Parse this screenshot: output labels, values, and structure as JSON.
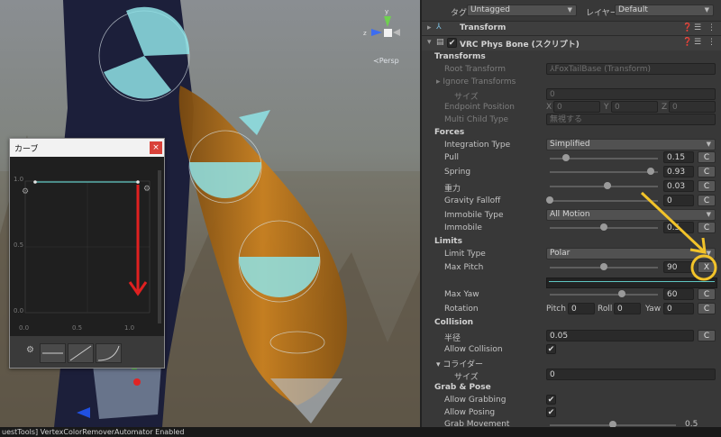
{
  "scene": {
    "persp_label": "≺Persp",
    "gizmo_axes": [
      "y",
      "z",
      "x"
    ]
  },
  "curve_window": {
    "title": "カーブ",
    "close_label": "×",
    "y_labels": [
      "1.0",
      "0.5",
      "0.0"
    ],
    "x_labels": [
      "0.0",
      "0.5",
      "1.0"
    ],
    "presets": [
      "flat-preset-icon",
      "linear-preset-icon",
      "ease-in-preset-icon"
    ],
    "gear_icon": "gear-icon"
  },
  "inspector": {
    "tag_label": "タグ",
    "tag_value": "Untagged",
    "layer_label": "レイヤー",
    "layer_value": "Default",
    "transform_title": "Transform",
    "component_title": "VRC Phys Bone (スクリプト)",
    "sections": {
      "transforms": "Transforms",
      "forces": "Forces",
      "limits": "Limits",
      "collision": "Collision",
      "grab_pose": "Grab & Pose"
    },
    "root_transform": {
      "label": "Root Transform",
      "value": "⅄FoxTailBase (Transform)"
    },
    "ignore_transforms": {
      "label": "Ignore Transforms",
      "size_label": "サイズ",
      "size_value": "0"
    },
    "endpoint_position": {
      "label": "Endpoint Position",
      "x_label": "X",
      "x": "0",
      "y_label": "Y",
      "y": "0",
      "z_label": "Z",
      "z": "0"
    },
    "multi_child_type": {
      "label": "Multi Child Type",
      "value": "無視する"
    },
    "integration_type": {
      "label": "Integration Type",
      "value": "Simplified"
    },
    "pull": {
      "label": "Pull",
      "value": "0.15",
      "level": 0.15
    },
    "spring": {
      "label": "Spring",
      "value": "0.93",
      "level": 0.93
    },
    "gravity": {
      "label": "重力",
      "value": "0.03",
      "level": 0.53
    },
    "gravity_falloff": {
      "label": "Gravity Falloff",
      "value": "0",
      "level": 0.0
    },
    "immobile_type": {
      "label": "Immobile Type",
      "value": "All Motion"
    },
    "immobile": {
      "label": "Immobile",
      "value": "0.5",
      "level": 0.5
    },
    "limit_type": {
      "label": "Limit Type",
      "value": "Polar"
    },
    "max_pitch": {
      "label": "Max Pitch",
      "value": "90",
      "level": 0.5
    },
    "max_yaw": {
      "label": "Max Yaw",
      "value": "60",
      "level": 0.67
    },
    "rotation": {
      "label": "Rotation",
      "pitch_label": "Pitch",
      "pitch": "0",
      "roll_label": "Roll",
      "roll": "0",
      "yaw_label": "Yaw",
      "yaw": "0"
    },
    "radius": {
      "label": "半径",
      "value": "0.05"
    },
    "allow_collision": {
      "label": "Allow Collision",
      "checked": "✔"
    },
    "colliders": {
      "label": "コライダー",
      "size_label": "サイズ",
      "size_value": "0"
    },
    "allow_grabbing": {
      "label": "Allow Grabbing",
      "checked": "✔"
    },
    "allow_posing": {
      "label": "Allow Posing",
      "checked": "✔"
    },
    "grab_movement": {
      "label": "Grab Movement",
      "value": "0.5",
      "level": 0.5
    },
    "c_label": "C",
    "x_label": "X"
  },
  "status_bar": {
    "text": "uestTools] VertexColorRemoverAutomator Enabled"
  },
  "annotation_color": "#f2c32a",
  "arrow_color": "#e02020"
}
